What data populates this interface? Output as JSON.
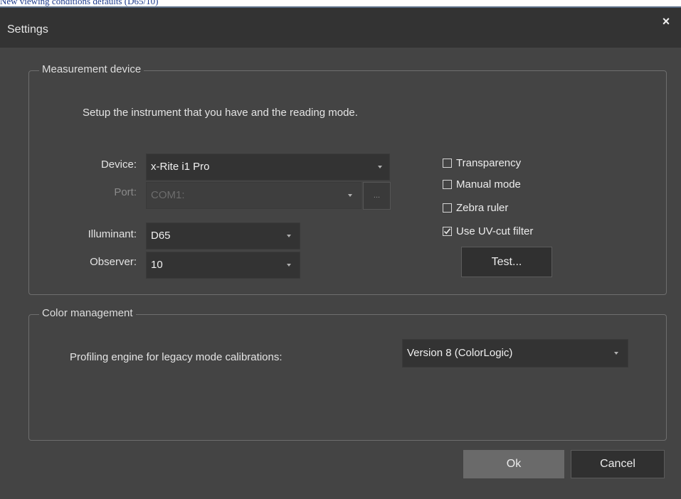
{
  "page": {
    "caption": "New viewing conditions defaults (D65/10)"
  },
  "dialog": {
    "title": "Settings",
    "close_glyph": "×"
  },
  "measurement": {
    "legend": "Measurement device",
    "intro": "Setup the instrument that you have and the reading mode.",
    "device": {
      "label": "Device:",
      "value": "x-Rite i1 Pro"
    },
    "port": {
      "label": "Port:",
      "value": "COM1:",
      "browse_label": "...",
      "enabled": false
    },
    "illuminant": {
      "label": "Illuminant:",
      "value": "D65"
    },
    "observer": {
      "label": "Observer:",
      "value": "10"
    },
    "options": {
      "transparency": {
        "label": "Transparency",
        "checked": false
      },
      "manual_mode": {
        "label": "Manual mode",
        "checked": false
      },
      "zebra_ruler": {
        "label": "Zebra ruler",
        "checked": false
      },
      "uv_cut": {
        "label": "Use UV-cut filter",
        "checked": true
      }
    },
    "test_button": "Test..."
  },
  "color_management": {
    "legend": "Color management",
    "engine_label": "Profiling engine for legacy mode calibrations:",
    "engine_value": "Version 8 (ColorLogic)"
  },
  "footer": {
    "ok": "Ok",
    "cancel": "Cancel"
  },
  "colors": {
    "dialog_bg": "#444444",
    "titlebar_bg": "#333333",
    "field_bg": "#333333",
    "primary_button_bg": "#6a6a6a",
    "caption_text": "#1f3c8c"
  }
}
